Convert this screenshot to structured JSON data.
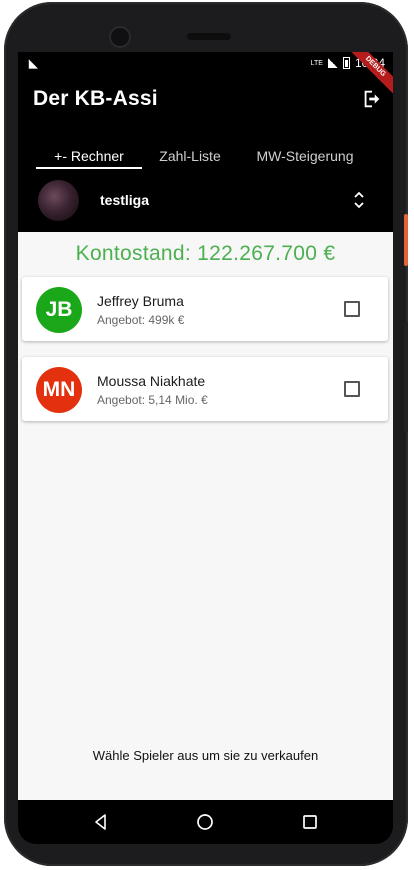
{
  "status": {
    "time": "10:24",
    "network": "LTE",
    "debug_label": "DEBUG"
  },
  "app": {
    "title": "Der KB-Assi"
  },
  "tabs": [
    {
      "label": "+- Rechner",
      "active": true
    },
    {
      "label": "Zahl-Liste",
      "active": false
    },
    {
      "label": "MW-Steigerung",
      "active": false
    }
  ],
  "league": {
    "name": "testliga"
  },
  "balance": {
    "text": "Kontostand: 122.267.700 €",
    "color": "#4caf50"
  },
  "players": [
    {
      "initials": "JB",
      "name": "Jeffrey Bruma",
      "offer": "Angebot: 499k €",
      "avatar_color": "#1aa81a",
      "checked": false
    },
    {
      "initials": "MN",
      "name": "Moussa Niakhate",
      "offer": "Angebot: 5,14 Mio. €",
      "avatar_color": "#e3300f",
      "checked": false
    }
  ],
  "hint": "Wähle Spieler aus um sie zu verkaufen",
  "icons": {
    "logout": "logout-icon",
    "league_switch": "unfold-icon",
    "nav_back": "back-triangle-icon",
    "nav_home": "home-circle-icon",
    "nav_recent": "recent-square-icon"
  }
}
